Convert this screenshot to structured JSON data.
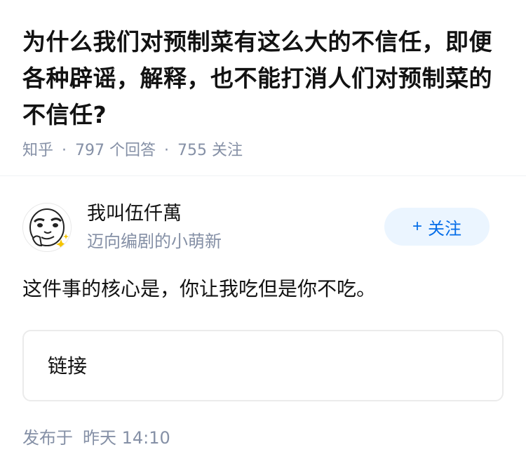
{
  "question": {
    "title": "为什么我们对预制菜有这么大的不信任，即便各种辟谣，解释，也不能打消人们对预制菜的不信任?",
    "source": "知乎",
    "answers": "797 个回答",
    "followers": "755 关注",
    "separator": "·"
  },
  "author": {
    "name": "我叫伍仟萬",
    "bio": "迈向编剧的小萌新",
    "avatar_icon": "cartoon-face-avatar",
    "follow_label": "关注",
    "follow_icon": "+"
  },
  "answer": {
    "text": "这件事的核心是，你让我吃但是你不吃。",
    "link_label": "链接"
  },
  "footer": {
    "publish_label": "发布于",
    "publish_time": "昨天 14:10"
  },
  "colors": {
    "accent": "#056de8",
    "accent_bg": "#ebf5ff",
    "meta": "#8590a6",
    "text": "#121212"
  }
}
